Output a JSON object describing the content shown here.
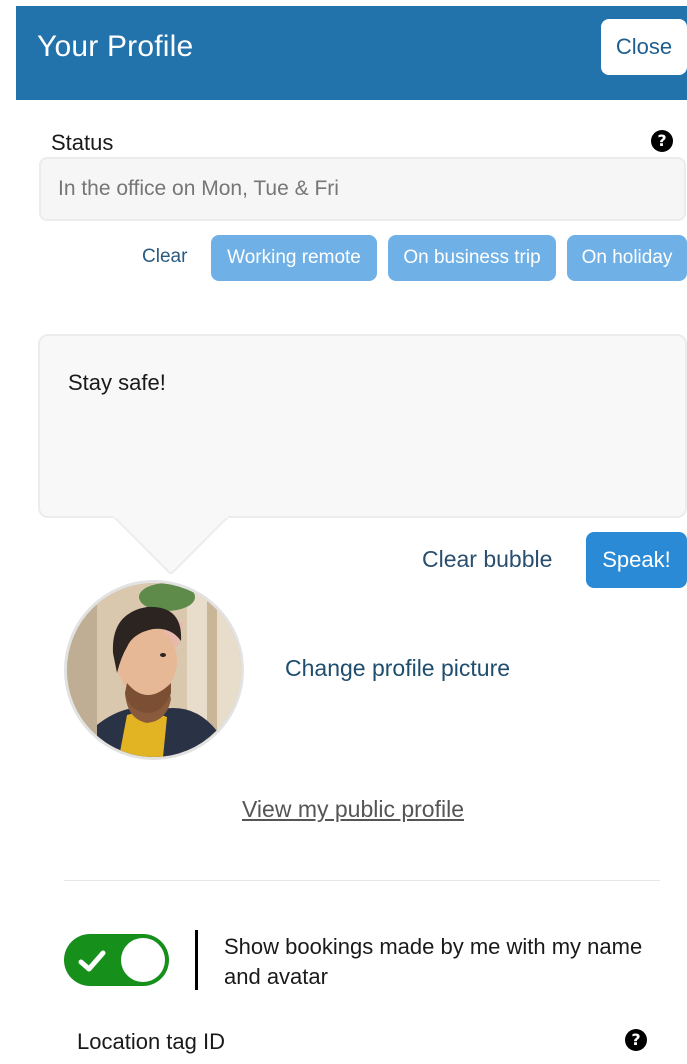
{
  "header": {
    "title": "Your Profile",
    "close_label": "Close",
    "background_color": "#2272ac"
  },
  "status": {
    "label": "Status",
    "help_icon": "question-circle-icon",
    "input_placeholder": "In the office on Mon, Tue & Fri",
    "input_value": "",
    "clear_label": "Clear",
    "presets": [
      "Working remote",
      "On business trip",
      "On holiday"
    ]
  },
  "speech_bubble": {
    "text": "Stay safe!",
    "clear_label": "Clear bubble",
    "speak_label": "Speak!"
  },
  "profile": {
    "change_picture_label": "Change profile picture",
    "view_public_profile_label": "View my public profile"
  },
  "bookings_toggle": {
    "enabled": true,
    "label": "Show bookings made by me with my name and avatar",
    "on_color": "#178f1b"
  },
  "location_tag": {
    "label": "Location tag ID",
    "help_icon": "question-circle-icon"
  }
}
